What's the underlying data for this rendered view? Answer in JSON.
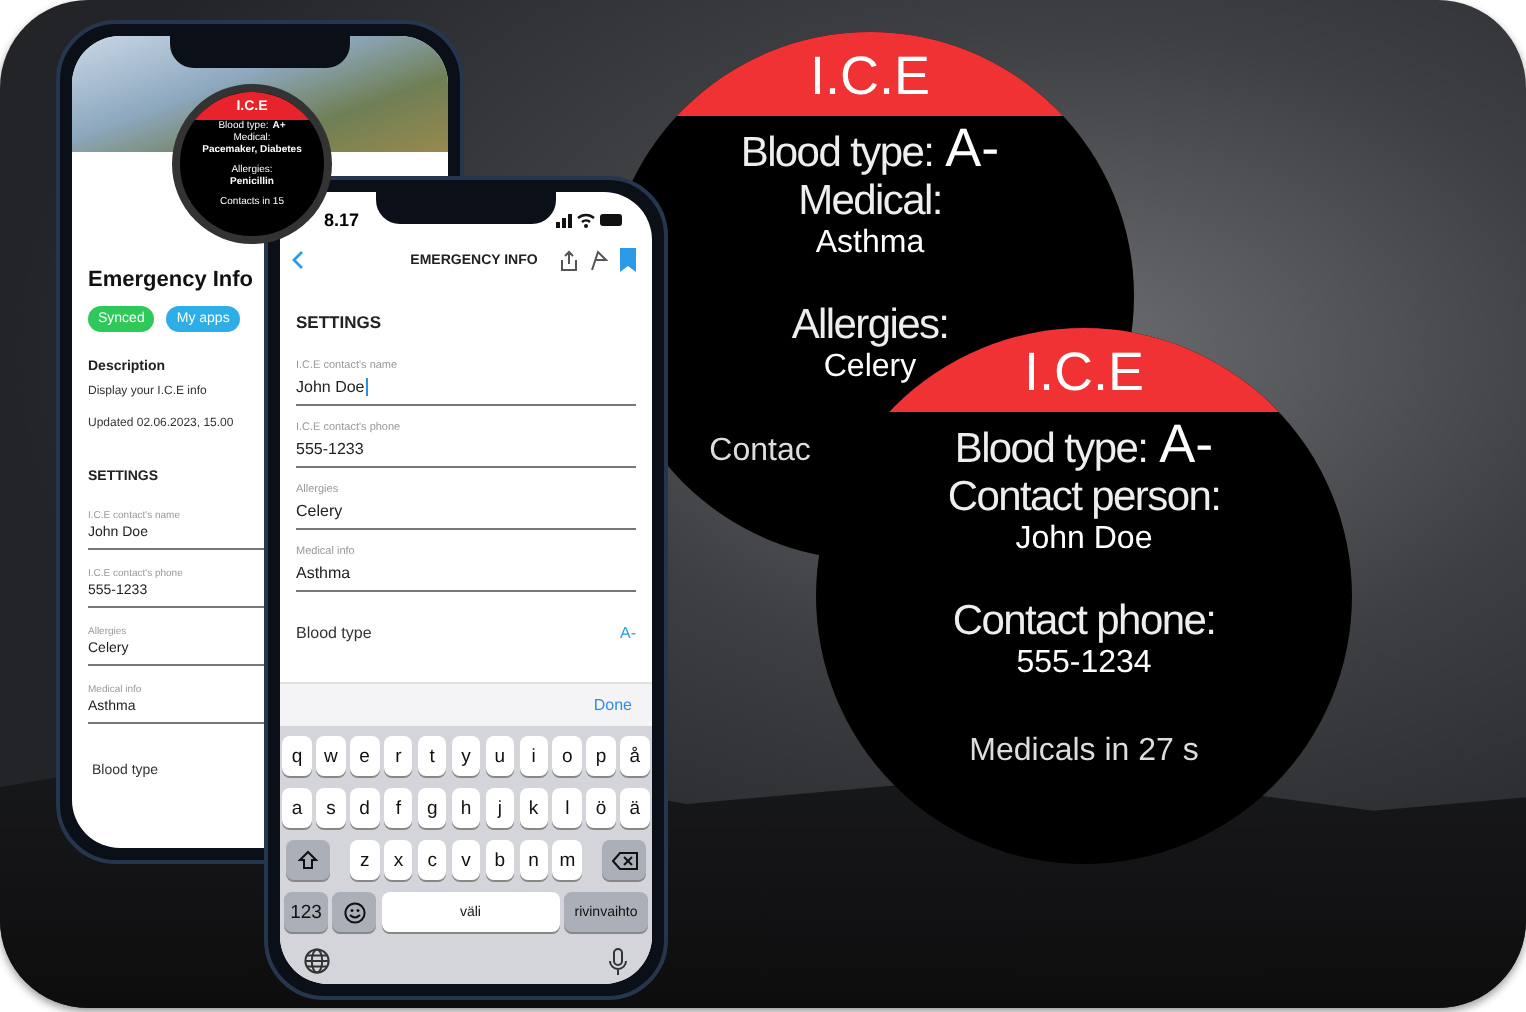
{
  "back_phone": {
    "header_watch": {
      "title": "I.C.E",
      "blood_type_label": "Blood type:",
      "blood_type": "A+",
      "lines": [
        "Medical:",
        "Pacemaker, Diabetes",
        "Allergies:",
        "Penicillin"
      ],
      "footer": "Contacts in 15"
    },
    "title": "Emergency Info",
    "badges": [
      {
        "label": "Synced",
        "color": "#2fc95a"
      },
      {
        "label": "My apps",
        "color": "#2eaee6"
      }
    ],
    "description_heading": "Description",
    "description": "Display your I.C.E info",
    "updated": "Updated 02.06.2023, 15.00",
    "settings_heading": "SETTINGS",
    "fields": [
      {
        "label": "I.C.E contact's name",
        "value": "John Doe"
      },
      {
        "label": "I.C.E contact's phone",
        "value": "555-1233"
      },
      {
        "label": "Allergies",
        "value": "Celery"
      },
      {
        "label": "Medical info",
        "value": "Asthma"
      }
    ],
    "last_row": "Blood type"
  },
  "front_phone": {
    "time": "8.17",
    "nav_title": "EMERGENCY INFO",
    "settings_heading": "SETTINGS",
    "fields": [
      {
        "label": "I.C.E contact's name",
        "value": "John Doe",
        "focused": true
      },
      {
        "label": "I.C.E contact's phone",
        "value": "555-1233",
        "focused": false
      },
      {
        "label": "Allergies",
        "value": "Celery",
        "focused": false
      },
      {
        "label": "Medical info",
        "value": "Asthma",
        "focused": false
      }
    ],
    "blood_type": {
      "label": "Blood type",
      "value": "A-"
    },
    "done": "Done",
    "keyboard": {
      "top_row": [
        "q",
        "w",
        "e",
        "r",
        "t",
        "y",
        "u",
        "i",
        "o",
        "p",
        "å"
      ],
      "middle_row": [
        "a",
        "s",
        "d",
        "f",
        "g",
        "h",
        "j",
        "k",
        "l",
        "ö",
        "ä"
      ],
      "bottom_row": [
        "z",
        "x",
        "c",
        "v",
        "b",
        "n",
        "m"
      ],
      "numbers_key": "123",
      "space_key": "väli",
      "return_key": "rivinvaihto"
    }
  },
  "watch_back": {
    "title": "I.C.E",
    "blood_type_label": "Blood type:",
    "blood_type": "A-",
    "items": [
      {
        "label": "Medical:",
        "value": "Asthma"
      },
      {
        "label": "Allergies:",
        "value": "Celery"
      }
    ],
    "footer": "Contac"
  },
  "watch_front": {
    "title": "I.C.E",
    "blood_type_label": "Blood type:",
    "blood_type": "A-",
    "items": [
      {
        "label": "Contact person:",
        "value": "John Doe"
      },
      {
        "label": "Contact phone:",
        "value": "555-1234"
      }
    ],
    "footer": "Medicals in 27 s"
  }
}
